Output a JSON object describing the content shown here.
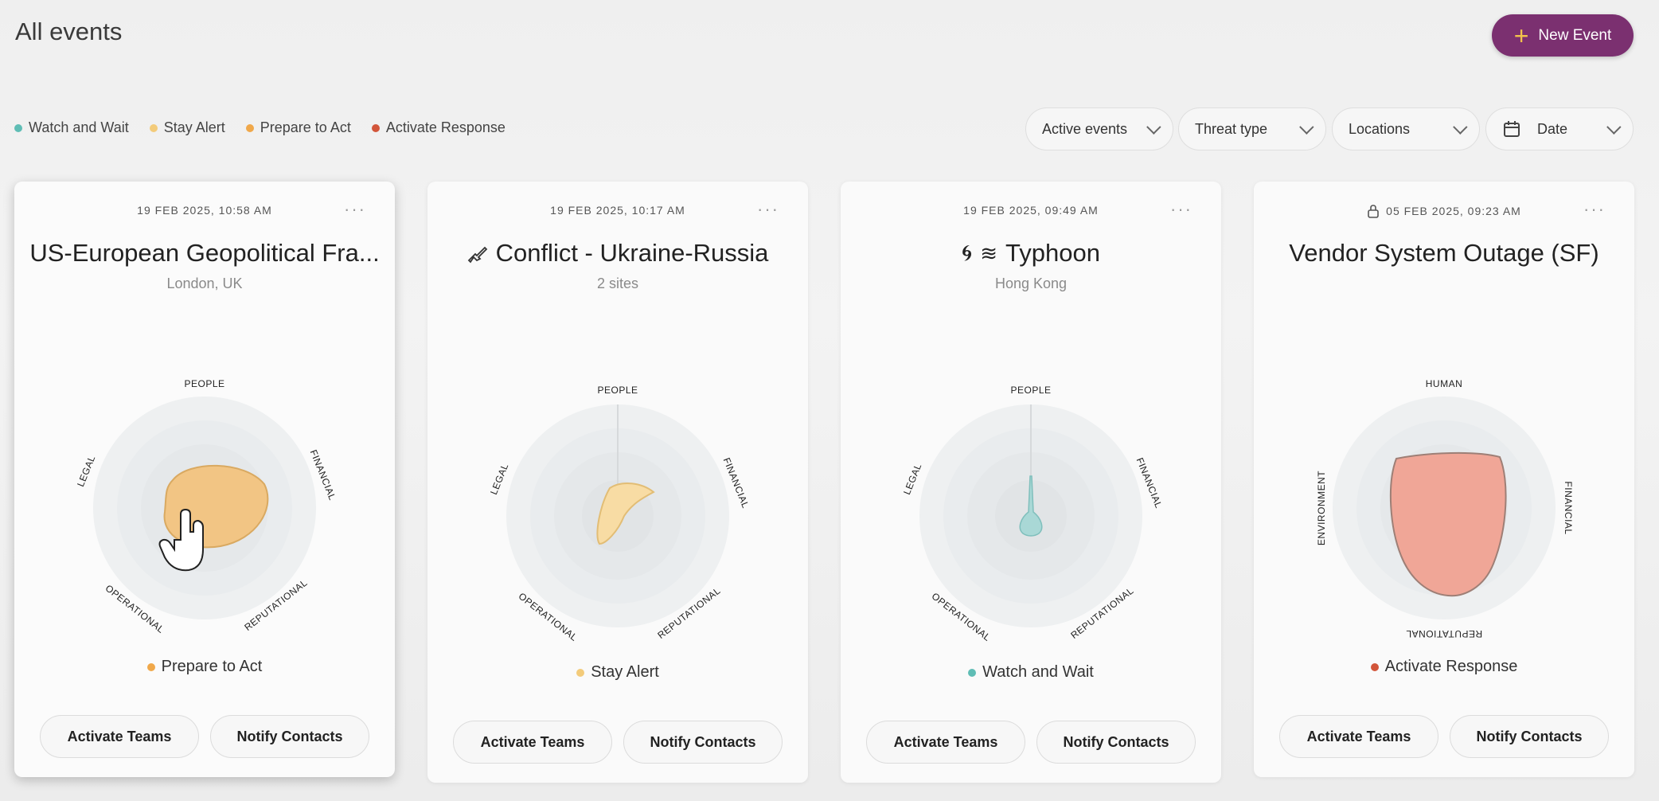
{
  "header": {
    "title": "All events",
    "new_event_label": "New Event"
  },
  "legend": [
    {
      "label": "Watch and Wait",
      "color": "#5fbdb5"
    },
    {
      "label": "Stay Alert",
      "color": "#f3cb7a"
    },
    {
      "label": "Prepare to Act",
      "color": "#f0a84a"
    },
    {
      "label": "Activate Response",
      "color": "#d2553a"
    }
  ],
  "filters": {
    "active_events": "Active events",
    "threat_type": "Threat type",
    "locations": "Locations",
    "date": "Date"
  },
  "icons": {
    "plus": "plus-icon",
    "chevron": "chevron-down-icon",
    "calendar": "calendar-icon",
    "more": "more-icon",
    "lock": "lock-icon",
    "weapon": "rifle-icon",
    "cyclone": "cyclone-icon",
    "wave": "waves-icon"
  },
  "cards": [
    {
      "date": "19 FEB 2025, 10:58 AM",
      "title": "US-European Geopolitical Fra...",
      "subtitle": "London, UK",
      "status": "Prepare to Act",
      "status_color": "#f0a84a",
      "axes": [
        "PEOPLE",
        "FINANCIAL",
        "REPUTATIONAL",
        "OPERATIONAL",
        "LEGAL"
      ],
      "activate_label": "Activate Teams",
      "notify_label": "Notify Contacts"
    },
    {
      "date": "19 FEB 2025, 10:17 AM",
      "title": "Conflict - Ukraine-Russia",
      "subtitle": "2 sites",
      "status": "Stay Alert",
      "status_color": "#f3cb7a",
      "axes": [
        "PEOPLE",
        "FINANCIAL",
        "REPUTATIONAL",
        "OPERATIONAL",
        "LEGAL"
      ],
      "activate_label": "Activate Teams",
      "notify_label": "Notify Contacts"
    },
    {
      "date": "19 FEB 2025, 09:49 AM",
      "title": "Typhoon",
      "subtitle": "Hong Kong",
      "status": "Watch and Wait",
      "status_color": "#5fbdb5",
      "axes": [
        "PEOPLE",
        "FINANCIAL",
        "REPUTATIONAL",
        "OPERATIONAL",
        "LEGAL"
      ],
      "activate_label": "Activate Teams",
      "notify_label": "Notify Contacts"
    },
    {
      "date": "05 FEB 2025, 09:23 AM",
      "title": "Vendor System Outage (SF)",
      "subtitle": "",
      "status": "Activate Response",
      "status_color": "#d2553a",
      "axes": [
        "HUMAN",
        "FINANCIAL",
        "REPUTATIONAL",
        "ENVIRONMENT"
      ],
      "activate_label": "Activate Teams",
      "notify_label": "Notify Contacts"
    }
  ]
}
